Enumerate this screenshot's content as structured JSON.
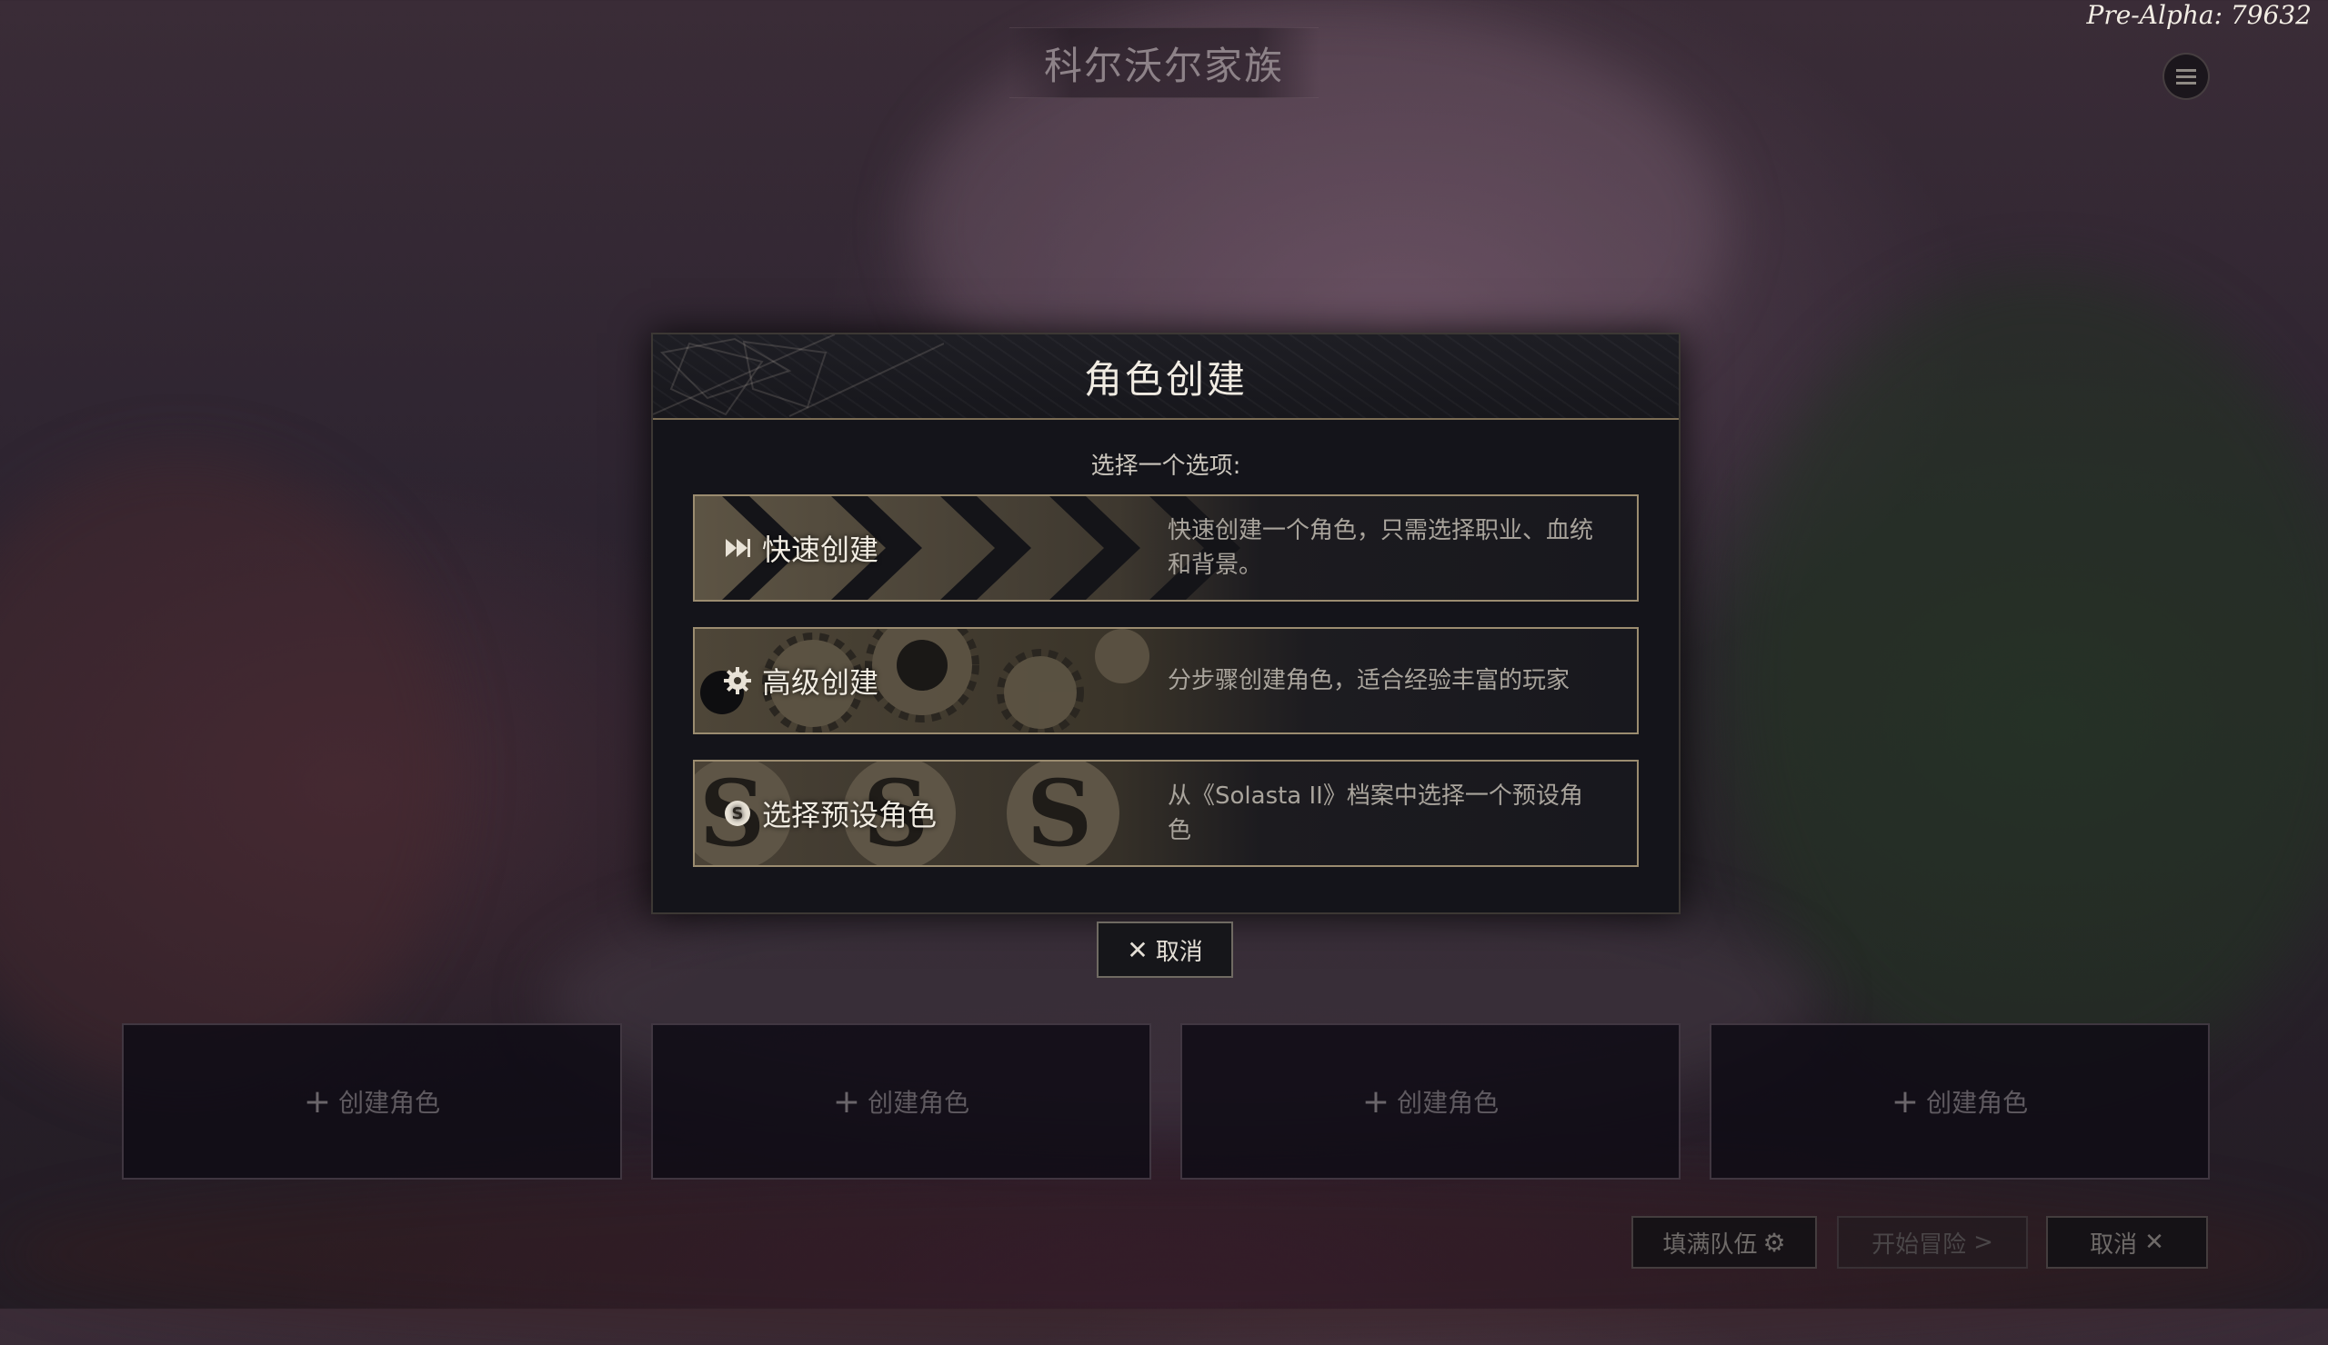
{
  "header": {
    "party_title": "科尔沃尔家族",
    "version": "Pre-Alpha: 79632",
    "menu_icon": "hamburger-menu-icon"
  },
  "modal": {
    "title": "角色创建",
    "subtitle": "选择一个选项:",
    "options": [
      {
        "label": "快速创建",
        "icon": "fast-forward-icon",
        "description": "快速创建一个角色，只需选择职业、血统和背景。"
      },
      {
        "label": "高级创建",
        "icon": "gear-icon",
        "description": "分步骤创建角色，适合经验丰富的玩家"
      },
      {
        "label": "选择预设角色",
        "icon": "solasta-s-icon",
        "description": "从《Solasta II》档案中选择一个预设角色"
      }
    ],
    "cancel_label": "取消"
  },
  "slots": [
    {
      "label": "创建角色"
    },
    {
      "label": "创建角色"
    },
    {
      "label": "创建角色"
    },
    {
      "label": "创建角色"
    }
  ],
  "footer": {
    "fill_party_label": "填满队伍",
    "start_adventure_label": "开始冒险",
    "cancel_label": "取消"
  },
  "colors": {
    "accent_gold": "#9b8c70",
    "modal_bg": "#14141a",
    "text_primary": "#f0ebe2"
  }
}
